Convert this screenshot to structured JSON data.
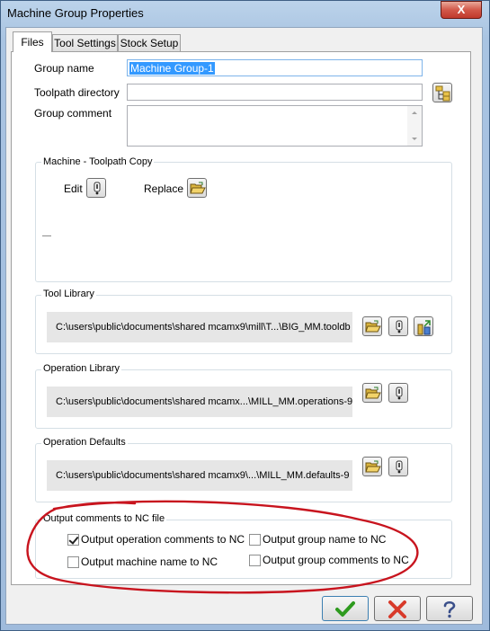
{
  "window": {
    "title": "Machine Group Properties",
    "close_label": "X"
  },
  "tabs": [
    {
      "label": "Files",
      "active": true
    },
    {
      "label": "Tool Settings",
      "active": false
    },
    {
      "label": "Stock Setup",
      "active": false
    }
  ],
  "files": {
    "group_name_label": "Group name",
    "group_name_value": "Machine Group-1",
    "toolpath_dir_label": "Toolpath directory",
    "toolpath_dir_value": "",
    "group_comment_label": "Group comment",
    "group_comment_value": ""
  },
  "machine_copy": {
    "title": "Machine - Toolpath Copy",
    "edit_label": "Edit",
    "replace_label": "Replace",
    "info": "—"
  },
  "tool_library": {
    "title": "Tool Library",
    "path": "C:\\users\\public\\documents\\shared mcamx9\\mill\\T...\\BIG_MM.tooldb"
  },
  "operation_library": {
    "title": "Operation Library",
    "path": "C:\\users\\public\\documents\\shared mcamx...\\MILL_MM.operations-9"
  },
  "operation_defaults": {
    "title": "Operation Defaults",
    "path": "C:\\users\\public\\documents\\shared mcamx9\\...\\MILL_MM.defaults-9"
  },
  "output_comments": {
    "title": "Output comments to NC file",
    "options": [
      {
        "label": "Output operation comments to NC",
        "checked": true
      },
      {
        "label": "Output group name to NC",
        "checked": false
      },
      {
        "label": "Output machine name to NC",
        "checked": false
      },
      {
        "label": "Output group comments to NC",
        "checked": false
      }
    ]
  },
  "colors": {
    "annotation": "#c8141e",
    "ok_green": "#2e9a1e",
    "cancel_red": "#d83a2a",
    "selection": "#3399ff"
  },
  "icons": [
    "close-icon",
    "folder-tree-icon",
    "edit-icon",
    "open-folder-icon",
    "scroll-up-icon",
    "scroll-down-icon",
    "tool-manager-icon",
    "ok-check-icon",
    "cancel-x-icon",
    "help-icon"
  ]
}
